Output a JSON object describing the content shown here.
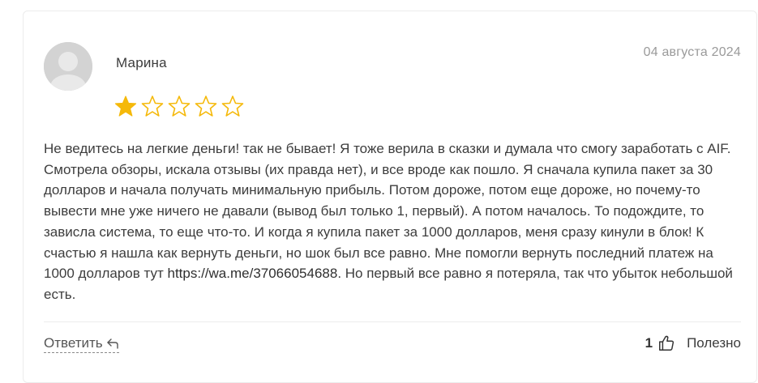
{
  "review": {
    "author": "Марина",
    "date": "04 августа 2024",
    "rating": 1,
    "rating_max": 5,
    "star_filled_color": "#f5b90a",
    "star_empty_color": "#f5b90a",
    "text_before_link": "Не ведитесь на легкие деньги! так не бывает! Я тоже верила в сказки и думала что смогу заработать с AIF. Смотрела обзоры, искала отзывы (их правда нет), и все вроде как пошло. Я сначала купила пакет за 30 долларов и начала получать минимальную прибыль. Потом дороже, потом еще дороже, но почему-то вывести мне уже ничего не давали (вывод был только 1, первый). А потом началось. То подождите, то зависла система, то еще что-то. И когда я купила пакет за 1000 долларов, меня сразу кинули в блок! К счастью я нашла как вернуть деньги, но шок был все равно. Мне помогли вернуть последний платеж на 1000 долларов тут ",
    "link_text": "https://wa.me/37066054688",
    "text_after_link": ". Но первый все равно я потеряла, так что убыток небольшой есть.",
    "avatar_icon": "user-silhouette-icon"
  },
  "footer": {
    "reply_label": "Ответить",
    "reply_icon": "reply-arrow-icon",
    "helpful_count": "1",
    "helpful_icon": "thumbs-up-icon",
    "helpful_label": "Полезно"
  }
}
